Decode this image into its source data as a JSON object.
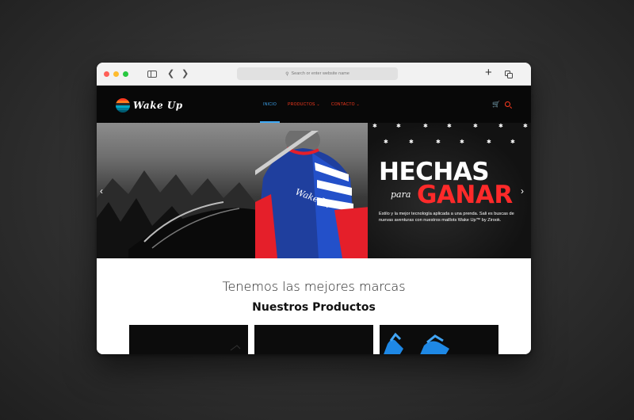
{
  "browser": {
    "url_placeholder": "Search or enter website name",
    "icons": [
      "sidebar-icon",
      "chevron-left-icon",
      "chevron-right-icon",
      "plus-icon",
      "tabs-icon",
      "search-icon"
    ]
  },
  "site": {
    "logo_text": "Wake Up",
    "nav": {
      "inicio": "INICIO",
      "productos": "PRODUCTOS ⌄",
      "contacto": "CONTACTO ⌄"
    },
    "colors": {
      "accent": "#ff3b1f",
      "active": "#3fa9f5",
      "header_bg": "#080808"
    }
  },
  "hero": {
    "title_line1": "HECHAS",
    "title_script": "para",
    "title_line2": "GANAR",
    "jersey_text": "Wake Up",
    "description": "Estilo y la mejor tecnología aplicada a una prenda. Sali es buscas de nuevas aventuras con nuestros maillots Wake Up™ by Zirook.",
    "prev_arrow": "‹",
    "next_arrow": "›"
  },
  "main": {
    "brands_heading": "Tenemos las mejores marcas",
    "products_heading": "Nuestros Productos"
  }
}
